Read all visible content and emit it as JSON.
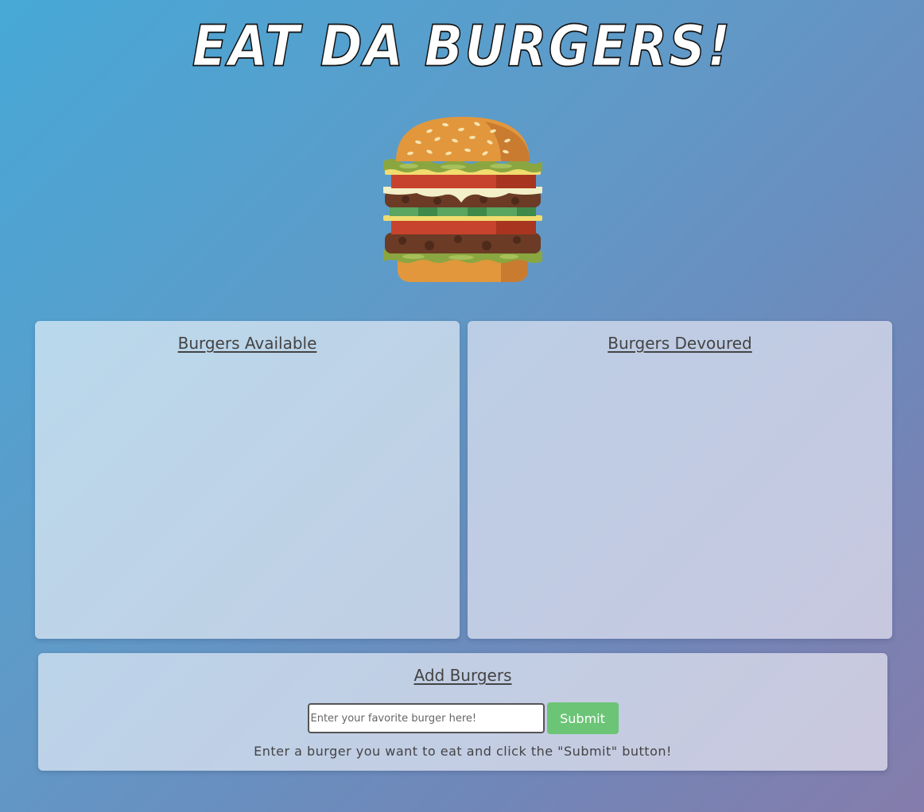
{
  "header": {
    "title": "Eat Da Burgers!",
    "logo_icon": "burger-icon"
  },
  "available": {
    "heading": "Burgers Available",
    "items": []
  },
  "devoured": {
    "heading": "Burgers Devoured",
    "items": []
  },
  "add": {
    "heading": "Add Burgers",
    "input_value": "",
    "input_placeholder": "Enter your favorite burger here!",
    "submit_label": "Submit",
    "instructions": "Enter a burger you want to eat and click the \"Submit\" button!"
  },
  "colors": {
    "submit_button": "#6cc476",
    "background_start": "#47a8d6",
    "background_end": "#857cab"
  }
}
